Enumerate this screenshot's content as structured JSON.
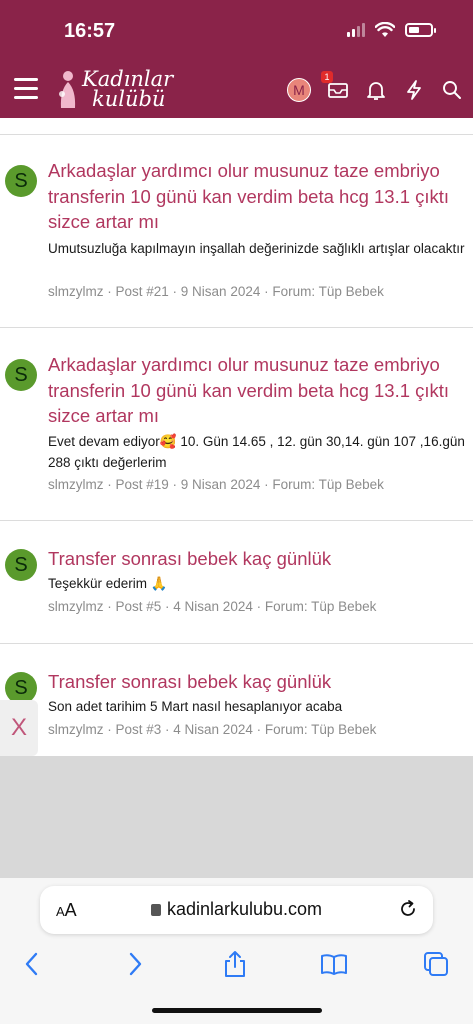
{
  "status_bar": {
    "time": "16:57"
  },
  "header": {
    "logo_line1": "Kadınlar",
    "logo_line2": "kulübü",
    "avatar_letter": "M",
    "inbox_badge": "1",
    "brand_color": "#8a2349"
  },
  "posts": [
    {
      "avatar_letter": "S",
      "title": "Arkadaşlar yardımcı olur musunuz taze embriyo transferin 10 günü kan verdim beta hcg 13.1 çıktı sizce artar mı",
      "snippet": "Umutsuzluğa kapılmayın inşallah değerinizde sağlıklı artışlar olacaktır",
      "author": "slmzylmz",
      "post_no": "Post #21",
      "date": "9 Nisan 2024",
      "forum": "Forum: Tüp Bebek"
    },
    {
      "avatar_letter": "S",
      "title": "Arkadaşlar yardımcı olur musunuz taze embriyo transferin 10 günü kan verdim beta hcg 13.1 çıktı sizce artar mı",
      "snippet": "Evet devam ediyor🥰 10. Gün 14.65 , 12. gün 30,14. gün 107 ,16.gün 288 çıktı değerlerim",
      "author": "slmzylmz",
      "post_no": "Post #19",
      "date": "9 Nisan 2024",
      "forum": "Forum: Tüp Bebek"
    },
    {
      "avatar_letter": "S",
      "title": "Transfer sonrası bebek kaç günlük",
      "snippet": "Teşekkür ederim 🙏",
      "author": "slmzylmz",
      "post_no": "Post #5",
      "date": "4 Nisan 2024",
      "forum": "Forum: Tüp Bebek"
    },
    {
      "avatar_letter": "S",
      "title": "Transfer sonrası bebek kaç günlük",
      "snippet": "Son adet tarihim 5 Mart nasıl hesaplanıyor acaba",
      "author": "slmzylmz",
      "post_no": "Post #3",
      "date": "4 Nisan 2024",
      "forum": "Forum: Tüp Bebek"
    }
  ],
  "meta_separator": " · ",
  "overlay": {
    "close_label": "X"
  },
  "browser": {
    "text_size_small": "A",
    "text_size_large": "A",
    "url": "kadinlarkulubu.com"
  }
}
